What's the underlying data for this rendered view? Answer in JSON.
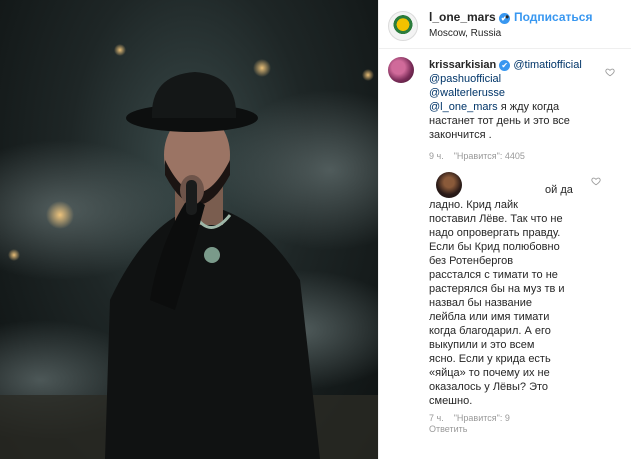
{
  "post": {
    "username": "l_one_mars",
    "separator": "•",
    "follow_label": "Подписаться",
    "location": "Moscow, Russia"
  },
  "comments": [
    {
      "username": "krissarkisian",
      "mention_1": "@timatiofficial",
      "mention_2": "@pashuofficial",
      "mention_3": "@walterlerusse",
      "mention_4": "@l_one_mars",
      "text_a": "я жду когда",
      "text_b": "настанет тот день и это все",
      "text_c": "закончится .",
      "time": "9 ч.",
      "likes": "\"Нравится\": 4405"
    },
    {
      "lines": [
        "ой да",
        "ладно. Крид лайк",
        "поставил Лёве. Так что не",
        "надо опровергать правду.",
        "Если бы Крид полюбовно",
        "без Ротенбергов",
        "расстался с тимати то не",
        "растерялся бы на муз тв и",
        "назвал бы название",
        "лейбла или имя тимати",
        "когда благодарил. А его",
        "выкупили и это всем",
        "ясно. Если у крида есть",
        "«яйца» то почему их не",
        "оказалось у Лёвы? Это",
        "смешно."
      ],
      "time": "7 ч.",
      "likes": "\"Нравится\": 9",
      "reply_label": "Ответить"
    }
  ],
  "icons": {
    "verified": "✔",
    "heart": "heart-outline-icon"
  },
  "colors": {
    "accent": "#3897f0",
    "mention": "#003569",
    "meta": "#999999"
  }
}
